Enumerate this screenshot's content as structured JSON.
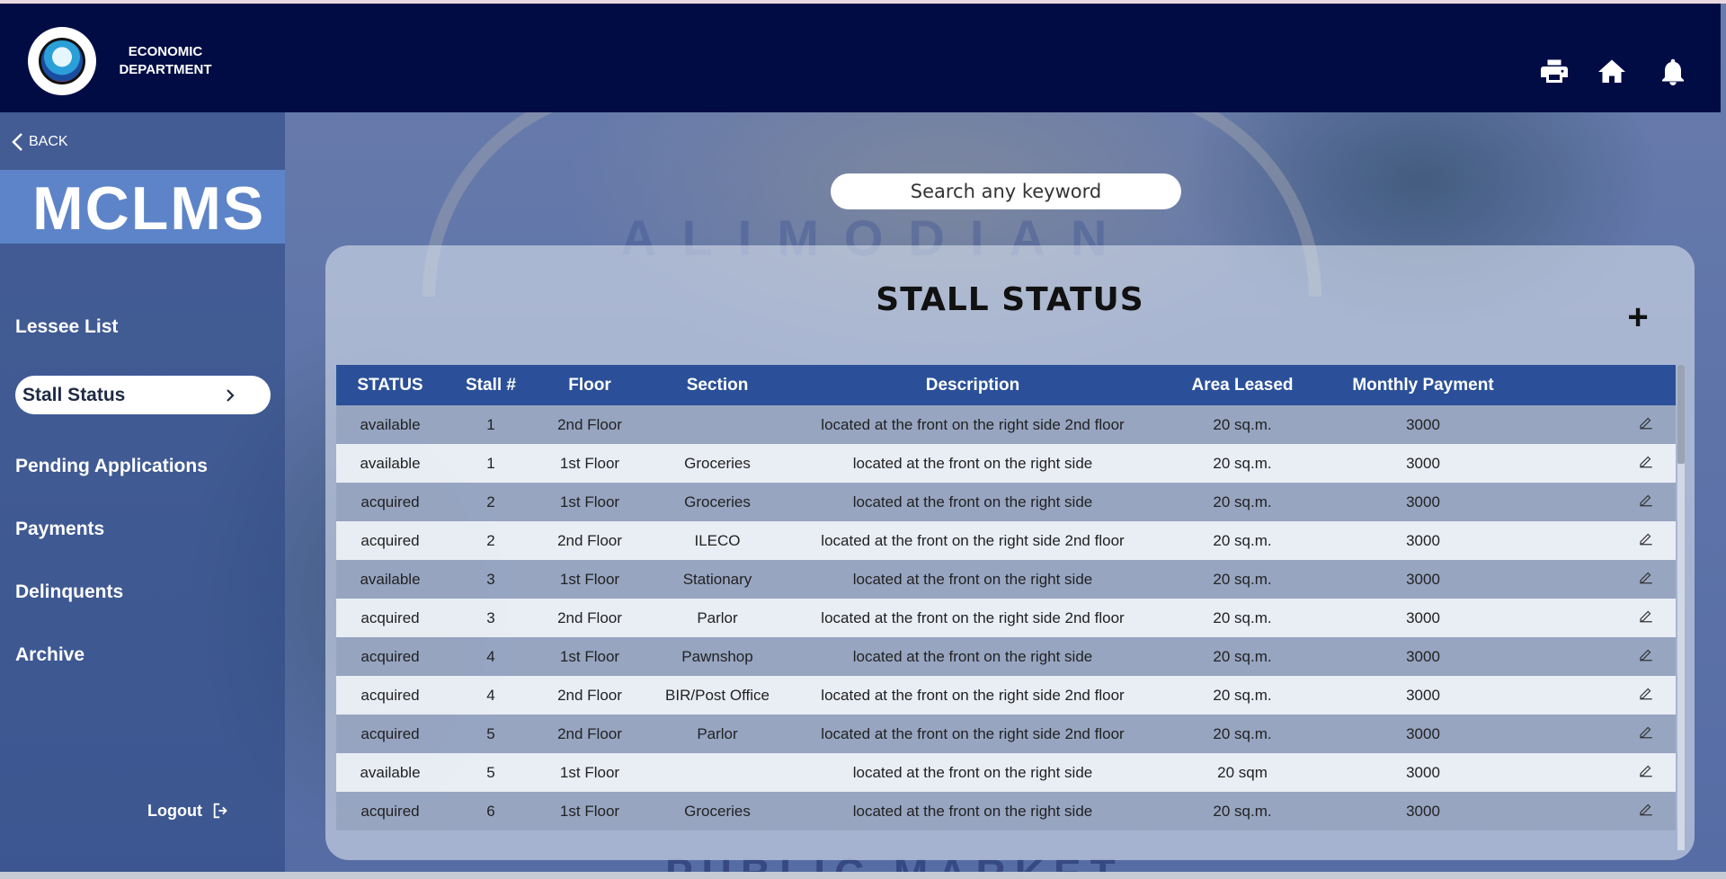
{
  "header": {
    "dept_line1": "ECONOMIC",
    "dept_line2": "DEPARTMENT",
    "icons": [
      "printer-icon",
      "home-icon",
      "bell-icon"
    ]
  },
  "background": {
    "word_top": "ALIMODIAN",
    "word_bottom": "PUBLIC MARKET"
  },
  "sidebar": {
    "back_label": "BACK",
    "brand": "MCLMS",
    "items": [
      {
        "label": "Lessee List"
      },
      {
        "label": "Stall Status"
      },
      {
        "label": "Pending Applications"
      },
      {
        "label": "Payments"
      },
      {
        "label": "Delinquents"
      },
      {
        "label": "Archive"
      }
    ],
    "active_index": 1,
    "logout_label": "Logout"
  },
  "search": {
    "placeholder": "Search any keyword"
  },
  "panel": {
    "title": "STALL STATUS",
    "add_label": "+"
  },
  "table": {
    "columns": [
      "STATUS",
      "Stall #",
      "Floor",
      "Section",
      "Description",
      "Area Leased",
      "Monthly Payment",
      ""
    ],
    "rows": [
      [
        "available",
        "1",
        "2nd Floor",
        "",
        "located at the front on the right side 2nd floor",
        "20 sq.m.",
        "3000"
      ],
      [
        "available",
        "1",
        "1st Floor",
        "Groceries",
        "located at the front on the right side",
        "20 sq.m.",
        "3000"
      ],
      [
        "acquired",
        "2",
        "1st Floor",
        "Groceries",
        "located at the front on the right side",
        "20 sq.m.",
        "3000"
      ],
      [
        "acquired",
        "2",
        "2nd Floor",
        "ILECO",
        "located at the front on the right side 2nd floor",
        "20 sq.m.",
        "3000"
      ],
      [
        "available",
        "3",
        "1st Floor",
        "Stationary",
        "located at the front on the right side",
        "20 sq.m.",
        "3000"
      ],
      [
        "acquired",
        "3",
        "2nd Floor",
        "Parlor",
        "located at the front on the right side 2nd floor",
        "20 sq.m.",
        "3000"
      ],
      [
        "acquired",
        "4",
        "1st Floor",
        "Pawnshop",
        "located at the front on the right side",
        "20 sq.m.",
        "3000"
      ],
      [
        "acquired",
        "4",
        "2nd Floor",
        "BIR/Post Office",
        "located at the front on the right side 2nd floor",
        "20 sq.m.",
        "3000"
      ],
      [
        "acquired",
        "5",
        "2nd Floor",
        "Parlor",
        "located at the front on the right side 2nd floor",
        "20 sq.m.",
        "3000"
      ],
      [
        "available",
        "5",
        "1st Floor",
        "",
        "located at the front on the right side",
        "20 sqm",
        "3000"
      ],
      [
        "acquired",
        "6",
        "1st Floor",
        "Groceries",
        "located at the front on the right side",
        "20 sq.m.",
        "3000"
      ]
    ]
  }
}
